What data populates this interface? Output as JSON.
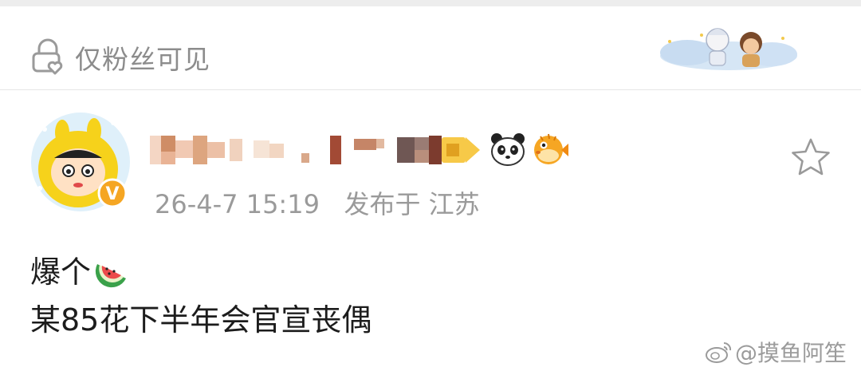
{
  "visibility": {
    "label": "仅粉丝可见",
    "icon": "lock-heart-icon"
  },
  "post": {
    "meta": "26-4-7 15:19   发布于 江苏",
    "lines": [
      "爆个",
      "某85花下半年会官宣丧偶"
    ],
    "line1_emoji": "watermelon-icon",
    "username_emojis": [
      "panda-icon",
      "pufferfish-icon"
    ],
    "favorite_icon": "star-icon",
    "avatar_badge": "V"
  },
  "watermark": {
    "text": "@摸鱼阿笙",
    "logo": "weibo-logo-icon"
  },
  "colors": {
    "muted_text": "#8c8c8c",
    "meta_text": "#9a9a9a",
    "body_text": "#1c1c1c",
    "verified_badge": "#f5a623"
  }
}
